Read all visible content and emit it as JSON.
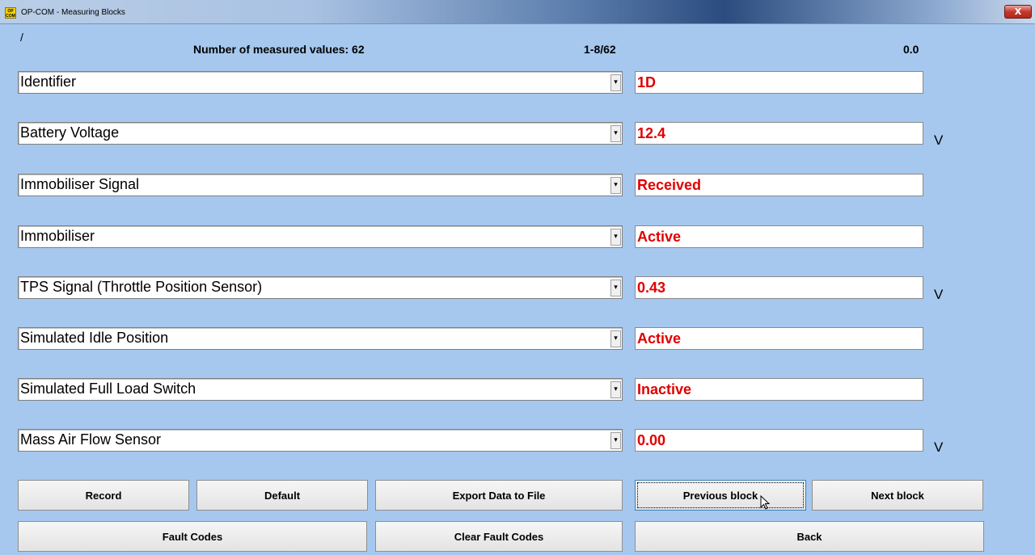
{
  "window": {
    "title": "OP-COM - Measuring Blocks",
    "icon_text": "OP COM",
    "close_glyph": "X"
  },
  "header": {
    "slash": "/",
    "count_text": "Number of measured values: 62",
    "range_text": "1-8/62",
    "timer_text": "0.0"
  },
  "rows": [
    {
      "label": "Identifier",
      "value": "1D",
      "unit": ""
    },
    {
      "label": "Battery Voltage",
      "value": "12.4",
      "unit": "V"
    },
    {
      "label": "Immobiliser Signal",
      "value": "Received",
      "unit": ""
    },
    {
      "label": "Immobiliser",
      "value": "Active",
      "unit": ""
    },
    {
      "label": "TPS Signal (Throttle Position Sensor)",
      "value": "0.43",
      "unit": "V"
    },
    {
      "label": "Simulated Idle Position",
      "value": "Active",
      "unit": ""
    },
    {
      "label": "Simulated Full Load Switch",
      "value": "Inactive",
      "unit": ""
    },
    {
      "label": "Mass Air Flow Sensor",
      "value": "0.00",
      "unit": "V"
    }
  ],
  "buttons": {
    "record": "Record",
    "default": "Default",
    "export": "Export Data to File",
    "previous": "Previous block",
    "next": "Next block",
    "fault_codes": "Fault Codes",
    "clear_fault_codes": "Clear Fault Codes",
    "back": "Back"
  },
  "colors": {
    "background": "#a6c8ee",
    "value_text": "#e00000"
  },
  "icons": {
    "combo_arrow": "dropdown-arrow-icon"
  }
}
